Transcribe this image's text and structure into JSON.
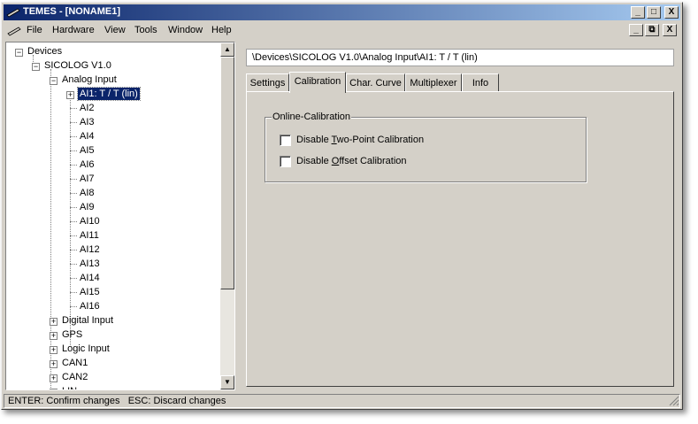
{
  "window": {
    "title": "TEMES - [NONAME1]",
    "controls": [
      "_",
      "□",
      "X"
    ],
    "mdi_controls": [
      "_",
      "⧉",
      "X"
    ]
  },
  "menu": [
    "File",
    "Hardware",
    "View",
    "Tools",
    "Window",
    "Help"
  ],
  "tree": {
    "root": "Devices",
    "device": "SICOLOG V1.0",
    "analog_group": "Analog Input",
    "selected": "AI1: T / T (lin)",
    "analog_channels": [
      "AI2",
      "AI3",
      "AI4",
      "AI5",
      "AI6",
      "AI7",
      "AI8",
      "AI9",
      "AI10",
      "AI11",
      "AI12",
      "AI13",
      "AI14",
      "AI15",
      "AI16"
    ],
    "groups": [
      "Digital Input",
      "GPS",
      "Logic Input",
      "CAN1",
      "CAN2"
    ],
    "partial_group": "LIN"
  },
  "path": "\\Devices\\SICOLOG V1.0\\Analog Input\\AI1: T / T (lin)",
  "tabs": [
    "Settings",
    "Calibration",
    "Char. Curve",
    "Multiplexer",
    "Info"
  ],
  "active_tab": "Calibration",
  "calibration": {
    "group_title": "Online-Calibration",
    "two_point": {
      "prefix": "Disable ",
      "accel": "T",
      "suffix": "wo-Point Calibration",
      "checked": false
    },
    "offset": {
      "prefix": "Disable ",
      "accel": "O",
      "suffix": "ffset Calibration",
      "checked": false
    }
  },
  "status": "ENTER: Confirm changes   ESC: Discard changes"
}
